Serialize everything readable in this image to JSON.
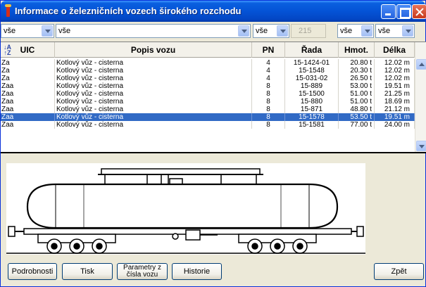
{
  "window": {
    "title": "Informace o železničních vozech širokého rozchodu"
  },
  "filters": {
    "uic": "vše",
    "popis": "vše",
    "pn": "vše",
    "pn_number": "215",
    "hmot": "vše",
    "delka": "vše"
  },
  "grid": {
    "headers": {
      "sort": "↓A\n↑Z",
      "uic": "UIC",
      "popis": "Popis vozu",
      "pn": "PN",
      "rada": "Řada",
      "hmot": "Hmot.",
      "delka": "Délka"
    },
    "rows": [
      {
        "uic": "Za",
        "popis": "Kotlový vůz - cisterna",
        "pn": "4",
        "rada": "15-1424-01",
        "hmot": "20.80 t",
        "delka": "12.02 m"
      },
      {
        "uic": "Za",
        "popis": "Kotlový vůz - cisterna",
        "pn": "4",
        "rada": "15-1548",
        "hmot": "20.30 t",
        "delka": "12.02 m"
      },
      {
        "uic": "Za",
        "popis": "Kotlový vůz - cisterna",
        "pn": "4",
        "rada": "15-031-02",
        "hmot": "26.50 t",
        "delka": "12.02 m"
      },
      {
        "uic": "Zaa",
        "popis": "Kotlový vůz - cisterna",
        "pn": "8",
        "rada": "15-889",
        "hmot": "53.00 t",
        "delka": "19.51 m"
      },
      {
        "uic": "Zaa",
        "popis": "Kotlový vůz - cisterna",
        "pn": "8",
        "rada": "15-1500",
        "hmot": "51.00 t",
        "delka": "21.25 m"
      },
      {
        "uic": "Zaa",
        "popis": "Kotlový vůz - cisterna",
        "pn": "8",
        "rada": "15-880",
        "hmot": "51.00 t",
        "delka": "18.69 m"
      },
      {
        "uic": "Zaa",
        "popis": "Kotlový vůz - cisterna",
        "pn": "8",
        "rada": "15-871",
        "hmot": "48.80 t",
        "delka": "21.12 m"
      },
      {
        "uic": "Zaa",
        "popis": "Kotlový vůz - cisterna",
        "pn": "8",
        "rada": "15-1578",
        "hmot": "53.50 t",
        "delka": "19.51 m"
      },
      {
        "uic": "Zaa",
        "popis": "Kotlový vůz - cisterna",
        "pn": "8",
        "rada": "15-1581",
        "hmot": "77.00 t",
        "delka": "24.00 m"
      }
    ],
    "selected_index": 7
  },
  "buttons": {
    "podrobnosti": "Podrobnosti",
    "tisk": "Tisk",
    "parametry_line1": "Parametry z",
    "parametry_line2": "čísla vozu",
    "historie": "Historie",
    "zpet": "Zpět"
  },
  "colors": {
    "selection": "#316ac5",
    "titlebar": "#0453d6"
  }
}
